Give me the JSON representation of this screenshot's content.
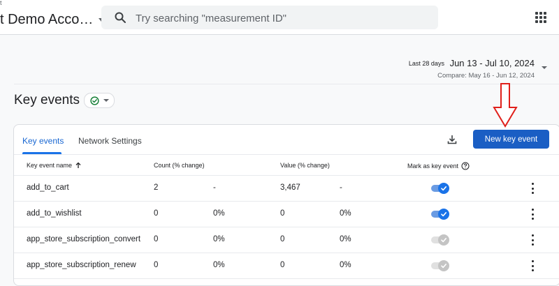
{
  "header": {
    "account_top": "t",
    "account_name": "t Demo Acco…",
    "search_placeholder": "Try searching \"measurement ID\""
  },
  "date_range": {
    "label": "Last 28 days",
    "range": "Jun 13 - Jul 10, 2024",
    "compare": "Compare: May 16 - Jun 12, 2024"
  },
  "page": {
    "title": "Key events"
  },
  "tabs": [
    {
      "label": "Key events",
      "active": true
    },
    {
      "label": "Network Settings",
      "active": false
    }
  ],
  "actions": {
    "new_button": "New key event"
  },
  "table": {
    "columns": [
      "Key event name",
      "Count (% change)",
      "Value (% change)",
      "Mark as key event"
    ],
    "rows": [
      {
        "name": "add_to_cart",
        "count": "2",
        "count_change": "-",
        "value": "3,467",
        "value_change": "-",
        "marked": true
      },
      {
        "name": "add_to_wishlist",
        "count": "0",
        "count_change": "0%",
        "value": "0",
        "value_change": "0%",
        "marked": true
      },
      {
        "name": "app_store_subscription_convert",
        "count": "0",
        "count_change": "0%",
        "value": "0",
        "value_change": "0%",
        "marked": false
      },
      {
        "name": "app_store_subscription_renew",
        "count": "0",
        "count_change": "0%",
        "value": "0",
        "value_change": "0%",
        "marked": false
      }
    ]
  },
  "colors": {
    "accent": "#1a73e8",
    "button": "#1a5ec4",
    "annotation_arrow": "#e0201b"
  },
  "icons": [
    "search-icon",
    "apps-grid-icon",
    "dropdown-caret-icon",
    "check-circle-icon",
    "download-icon",
    "sort-arrow-up-icon",
    "help-circle-icon",
    "checkmark-icon",
    "more-vert-icon",
    "annotation-arrow"
  ]
}
